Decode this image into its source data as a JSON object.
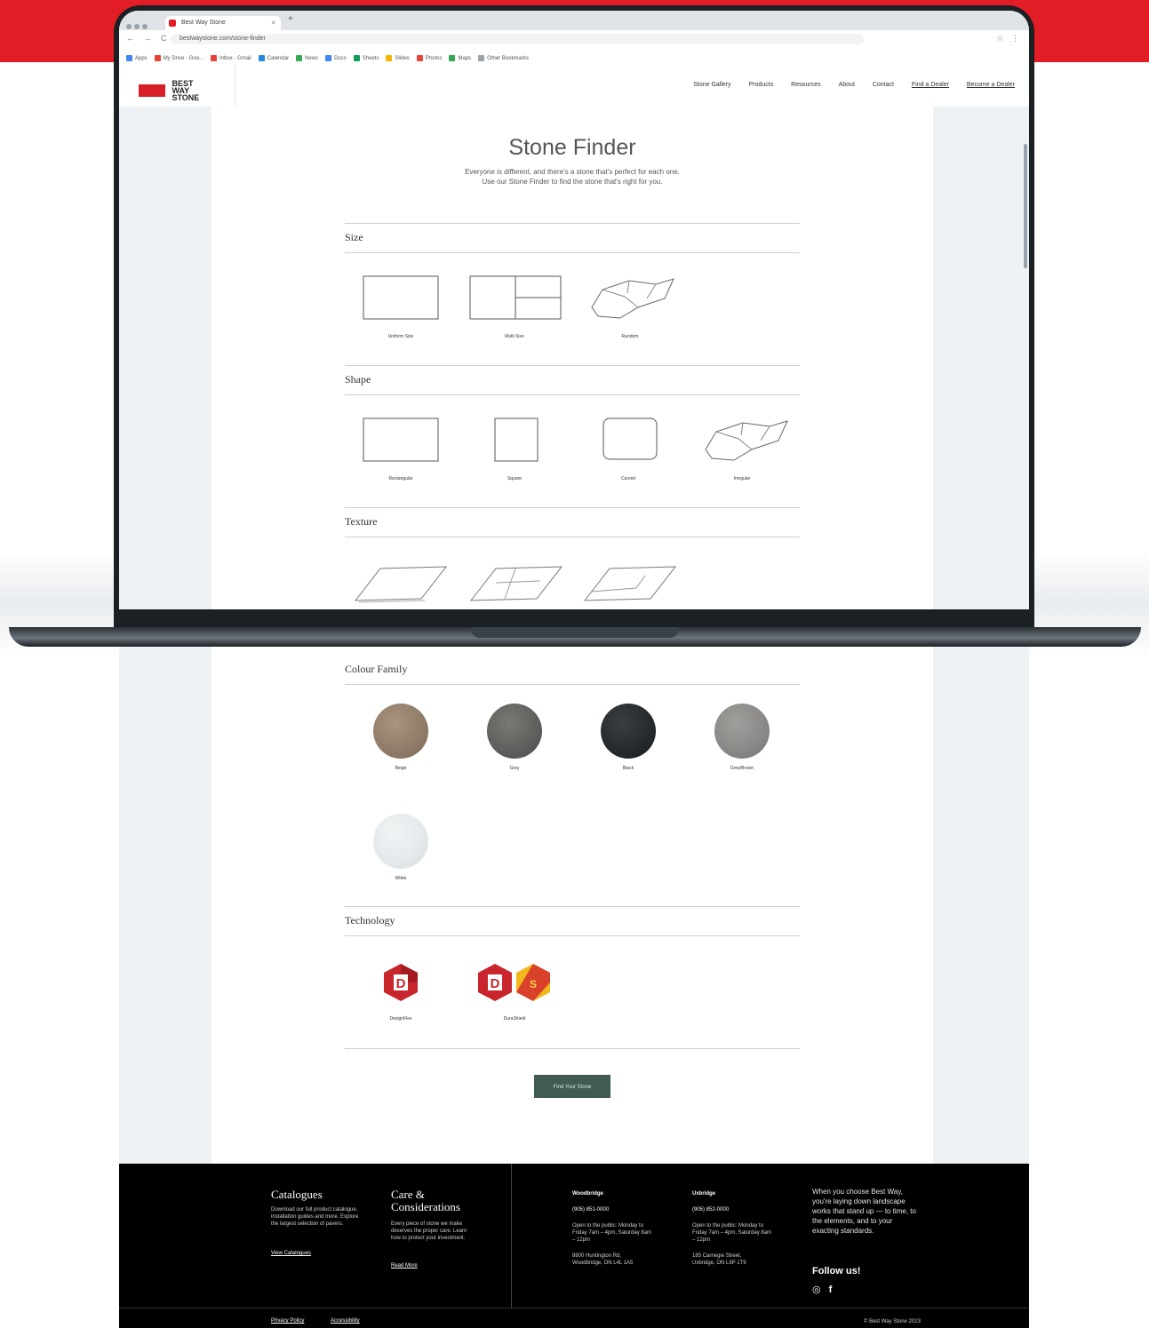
{
  "browser": {
    "tab_title": "Best Way Stone",
    "tab_close": "×",
    "new_tab": "+",
    "nav_buttons": "← → C",
    "address": "bestwaystone.com/stone-finder",
    "extras": "☆ ⋮",
    "bookmarks": [
      {
        "label": "Apps",
        "color": "#4285f4"
      },
      {
        "label": "My Drive - Goo...",
        "color": "#e94235"
      },
      {
        "label": "Inbox - Gmail",
        "color": "#e94235"
      },
      {
        "label": "Calendar",
        "color": "#1e88e5"
      },
      {
        "label": "News",
        "color": "#34a853"
      },
      {
        "label": "Docs",
        "color": "#4285f4"
      },
      {
        "label": "Sheets",
        "color": "#0f9d58"
      },
      {
        "label": "Slides",
        "color": "#f4b400"
      },
      {
        "label": "Photos",
        "color": "#ea4335"
      },
      {
        "label": "Maps",
        "color": "#34a853"
      },
      {
        "label": "Other Bookmarks",
        "color": "#9aa3ab"
      }
    ]
  },
  "header": {
    "logo_text": "BEST WAY STONE",
    "nav": [
      "Stone Gallery",
      "Products",
      "Resources",
      "About",
      "Contact"
    ],
    "nav_underlined": [
      "Find a Dealer",
      "Become a Dealer"
    ]
  },
  "main": {
    "title": "Stone Finder",
    "subtitle_line1": "Everyone is different, and there's a stone that's perfect for each one.",
    "subtitle_line2": "Use our Stone Finder to find the stone that's right for you.",
    "sections": {
      "size": {
        "title": "Size",
        "options": [
          "Uniform Size",
          "Multi Size",
          "Random"
        ]
      },
      "shape": {
        "title": "Shape",
        "options": [
          "Rectangular",
          "Square",
          "Curved",
          "Irregular"
        ]
      },
      "texture": {
        "title": "Texture"
      },
      "colour": {
        "title": "Colour Family",
        "options": [
          {
            "label": "Beige",
            "color": "#8f7b67"
          },
          {
            "label": "Grey",
            "color": "#5c5f5b"
          },
          {
            "label": "Black",
            "color": "#26292c"
          },
          {
            "label": "Grey/Brown",
            "color": "#8a8886"
          },
          {
            "label": "White",
            "color": "#e3e8ea"
          }
        ]
      },
      "technology": {
        "title": "Technology",
        "options": [
          "DesignFlex",
          "DuraShield"
        ]
      }
    },
    "find_button": "Find Your Stone"
  },
  "footer": {
    "catalogues": {
      "title": "Catalogues",
      "text": "Download our full product catalogue, installation guides and more. Explore the largest selection of pavers.",
      "link": "View Catalogues"
    },
    "care": {
      "title": "Care & Considerations",
      "text": "Every piece of stone we make deserves the proper care. Learn how to protect your investment.",
      "link": "Read More"
    },
    "loc1": {
      "title": "Woodbridge",
      "phone": "(905) 851-0000",
      "hours": "Open to the public: Monday to Friday 7am – 4pm, Saturday 8am – 12pm",
      "address": "8800 Huntington Rd, Woodbridge, ON L4L 1A5"
    },
    "loc2": {
      "title": "Uxbridge",
      "phone": "(905) 852-0000",
      "hours": "Open to the public: Monday to Friday 7am – 4pm, Saturday 8am – 12pm",
      "address": "185 Carnegie Street, Uxbridge, ON L9P 1T9"
    },
    "promo": "When you choose Best Way, you're laying down landscape works that stand up — to time, to the elements, and to your exacting standards.",
    "follow": "Follow us!",
    "social_instagram": "◎",
    "social_facebook": "f",
    "bottom_links": [
      "Privacy Policy",
      "Accessibility"
    ],
    "copyright": "© Best Way Stone 2023"
  }
}
